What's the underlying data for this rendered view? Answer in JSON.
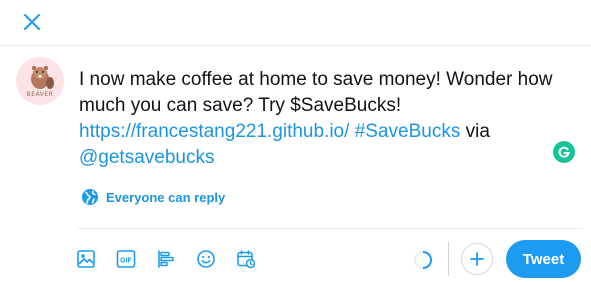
{
  "header": {
    "close_icon": "close-icon"
  },
  "avatar": {
    "caption": "BEAVER"
  },
  "compose": {
    "text_line": "I now make coffee at home to save money! Wonder how much you can save? Try $SaveBucks!",
    "link_url": "https://francestang221.github.io/",
    "hashtag": "#SaveBucks",
    "via_word": "via",
    "mention": "@getsavebucks"
  },
  "reply_setting": {
    "icon": "globe-icon",
    "label": "Everyone can reply"
  },
  "toolbar": {
    "icons": [
      "image-icon",
      "gif-icon",
      "poll-icon",
      "emoji-icon",
      "schedule-icon"
    ],
    "gif_label": "GIF",
    "counter_icon": "character-counter-icon",
    "add_icon": "plus-icon",
    "tweet_label": "Tweet"
  },
  "colors": {
    "accent": "#1d9bf0",
    "link": "#1b95e0",
    "grammarly": "#15c39a",
    "divider": "#e6ecf0"
  }
}
